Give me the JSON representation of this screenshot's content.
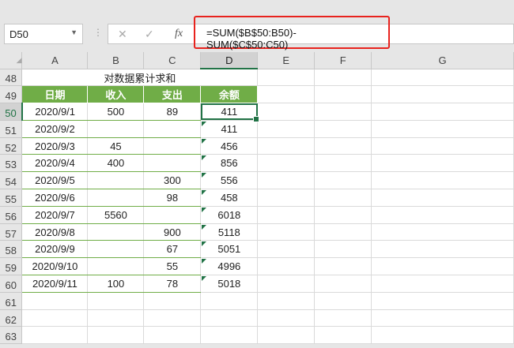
{
  "name_box": "D50",
  "formula": "=SUM($B$50:B50)-SUM($C$50:C50)",
  "fx_label": "fx",
  "columns": [
    "A",
    "B",
    "C",
    "D",
    "E",
    "F",
    "G"
  ],
  "title": "对数据累计求和",
  "headers": [
    "日期",
    "收入",
    "支出",
    "余额"
  ],
  "row_numbers": [
    "48",
    "49",
    "50",
    "51",
    "52",
    "53",
    "54",
    "55",
    "56",
    "57",
    "58",
    "59",
    "60",
    "61",
    "62",
    "63"
  ],
  "rows": [
    [
      "2020/9/1",
      "500",
      "89",
      "411"
    ],
    [
      "2020/9/2",
      "",
      "",
      "411"
    ],
    [
      "2020/9/3",
      "45",
      "",
      "456"
    ],
    [
      "2020/9/4",
      "400",
      "",
      "856"
    ],
    [
      "2020/9/5",
      "",
      "300",
      "556"
    ],
    [
      "2020/9/6",
      "",
      "98",
      "458"
    ],
    [
      "2020/9/7",
      "5560",
      "",
      "6018"
    ],
    [
      "2020/9/8",
      "",
      "900",
      "5118"
    ],
    [
      "2020/9/9",
      "",
      "67",
      "5051"
    ],
    [
      "2020/9/10",
      "",
      "55",
      "4996"
    ],
    [
      "2020/9/11",
      "100",
      "78",
      "5018"
    ]
  ],
  "colors": {
    "header_green": "#70ad47",
    "selection": "#217346",
    "highlight": "#e8231e"
  }
}
